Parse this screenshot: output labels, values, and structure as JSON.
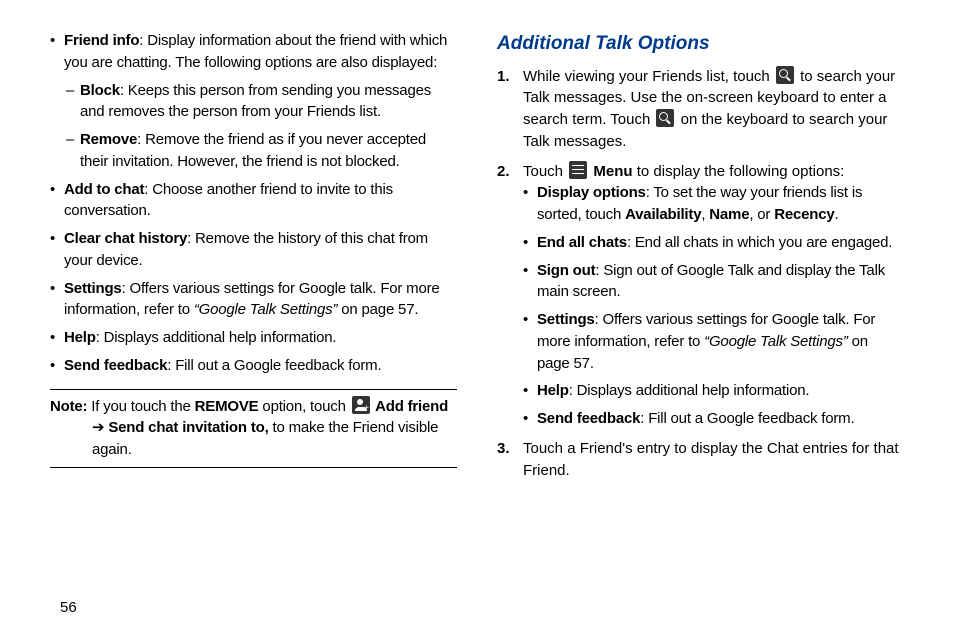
{
  "pageNumber": "56",
  "left": {
    "bullets": [
      {
        "label": "Friend info",
        "text": ": Display information about the friend with which you are chatting. The following options are also displayed:",
        "sub": [
          {
            "label": "Block",
            "text": ": Keeps this person from sending you messages and removes the person from your Friends list."
          },
          {
            "label": "Remove",
            "text": ": Remove the friend as if you never accepted their invitation. However, the friend is not blocked."
          }
        ]
      },
      {
        "label": "Add to chat",
        "text": ": Choose another friend to invite to this conversation."
      },
      {
        "label": "Clear chat history",
        "text": ": Remove the history of this chat from your device."
      },
      {
        "label": "Settings",
        "text": ": Offers various settings for Google talk. For more information, refer to ",
        "ref_italic": "“Google Talk Settings”",
        "ref_after": " on page 57."
      },
      {
        "label": "Help",
        "text": ": Displays additional help information."
      },
      {
        "label": "Send feedback",
        "text": ": Fill out a Google feedback form."
      }
    ],
    "note": {
      "prefix": "Note:",
      "line1a": " If you touch the ",
      "removeWord": "REMOVE",
      "line1b": " option, touch ",
      "addFriend": " Add friend",
      "line2a": "➔ ",
      "sendInv": "Send chat invitation to,",
      "line2b": " to make the Friend visible again."
    }
  },
  "right": {
    "title": "Additional Talk Options",
    "steps": [
      {
        "parts": [
          {
            "t": "While viewing your Friends list, touch "
          },
          {
            "icon": "search"
          },
          {
            "t": " to search your Talk messages. Use the on-screen keyboard to enter a search term. Touch "
          },
          {
            "icon": "search"
          },
          {
            "t": " on the keyboard to search your Talk messages."
          }
        ]
      },
      {
        "parts": [
          {
            "t": "Touch "
          },
          {
            "icon": "menu"
          },
          {
            "t": " "
          },
          {
            "b": "Menu"
          },
          {
            "t": " to display the following options:"
          }
        ],
        "sub": [
          {
            "spans": [
              {
                "b": "Display options"
              },
              {
                "t": ": To set the way your friends list is sorted, touch "
              },
              {
                "b": "Availability"
              },
              {
                "t": ", "
              },
              {
                "b": "Name"
              },
              {
                "t": ", or "
              },
              {
                "b": "Recency"
              },
              {
                "t": "."
              }
            ]
          },
          {
            "spans": [
              {
                "b": "End all chats"
              },
              {
                "t": ": End all chats in which you are engaged."
              }
            ]
          },
          {
            "spans": [
              {
                "b": "Sign out"
              },
              {
                "t": ": Sign out of Google Talk and display the Talk main screen."
              }
            ]
          },
          {
            "spans": [
              {
                "b": "Settings"
              },
              {
                "t": ": Offers various settings for Google talk. For more information, refer to "
              },
              {
                "i": "“Google Talk Settings”"
              },
              {
                "t": " on page 57."
              }
            ]
          },
          {
            "spans": [
              {
                "b": "Help"
              },
              {
                "t": ": Displays additional help information."
              }
            ]
          },
          {
            "spans": [
              {
                "b": "Send feedback"
              },
              {
                "t": ": Fill out a Google feedback form."
              }
            ]
          }
        ]
      },
      {
        "parts": [
          {
            "t": "Touch a Friend's entry to display the Chat entries for that Friend."
          }
        ]
      }
    ]
  }
}
